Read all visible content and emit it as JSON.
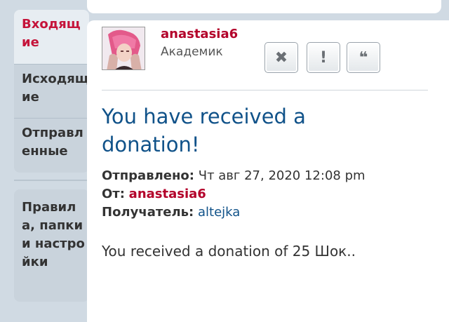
{
  "sidebar": {
    "items": [
      {
        "label": "Входящие"
      },
      {
        "label": "Исходящие"
      },
      {
        "label": "Отправленные"
      }
    ],
    "rules_label": "Правила, папки и настройки"
  },
  "post": {
    "author": "anastasia6",
    "rank": "Академик",
    "title": "You have received a donation!",
    "sent_label": "Отправлено:",
    "sent_value": "Чт авг 27, 2020 12:08 pm",
    "from_label": "От:",
    "from_value": "anastasia6",
    "recipient_label": "Получатель:",
    "recipient_value": "altejka",
    "body": "You received a donation of 25 Шок.."
  },
  "buttons": {
    "delete_icon": "✖",
    "report_icon": "!",
    "quote_icon": "❝"
  },
  "colors": {
    "accent": "#105289",
    "username": "#b3002a",
    "background": "#d0dae3"
  }
}
